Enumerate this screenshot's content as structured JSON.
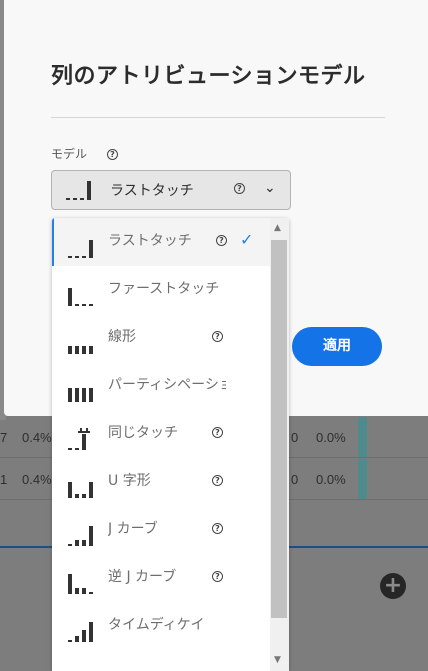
{
  "dialog": {
    "title": "列のアトリビューションモデル",
    "model_label": "モデル",
    "selected_value": "ラストタッチ",
    "apply_label": "適用"
  },
  "menu": {
    "items": [
      {
        "label": "ラストタッチ",
        "selected": true,
        "icon": "last-touch-icon",
        "help": true
      },
      {
        "label": "ファーストタッチ",
        "selected": false,
        "icon": "first-touch-icon",
        "help": false
      },
      {
        "label": "線形",
        "selected": false,
        "icon": "linear-icon",
        "help": true
      },
      {
        "label": "パーティシペーション",
        "selected": false,
        "icon": "participation-icon",
        "help": false
      },
      {
        "label": "同じタッチ",
        "selected": false,
        "icon": "same-touch-icon",
        "help": true
      },
      {
        "label": "U 字形",
        "selected": false,
        "icon": "u-shaped-icon",
        "help": true
      },
      {
        "label": "J カーブ",
        "selected": false,
        "icon": "j-curve-icon",
        "help": true
      },
      {
        "label": "逆 J カーブ",
        "selected": false,
        "icon": "inverse-j-curve-icon",
        "help": true
      },
      {
        "label": "タイムディケイ",
        "selected": false,
        "icon": "time-decay-icon",
        "help": false
      }
    ]
  },
  "background_table": {
    "rows": [
      {
        "left_a": "7",
        "left_b": "0.4%",
        "right_a": "0",
        "right_b": "0.0%"
      },
      {
        "left_a": "1",
        "left_b": "0.4%",
        "right_a": "0",
        "right_b": "0.0%"
      }
    ]
  },
  "colors": {
    "accent": "#1473e6",
    "selected_check": "#2680eb"
  }
}
